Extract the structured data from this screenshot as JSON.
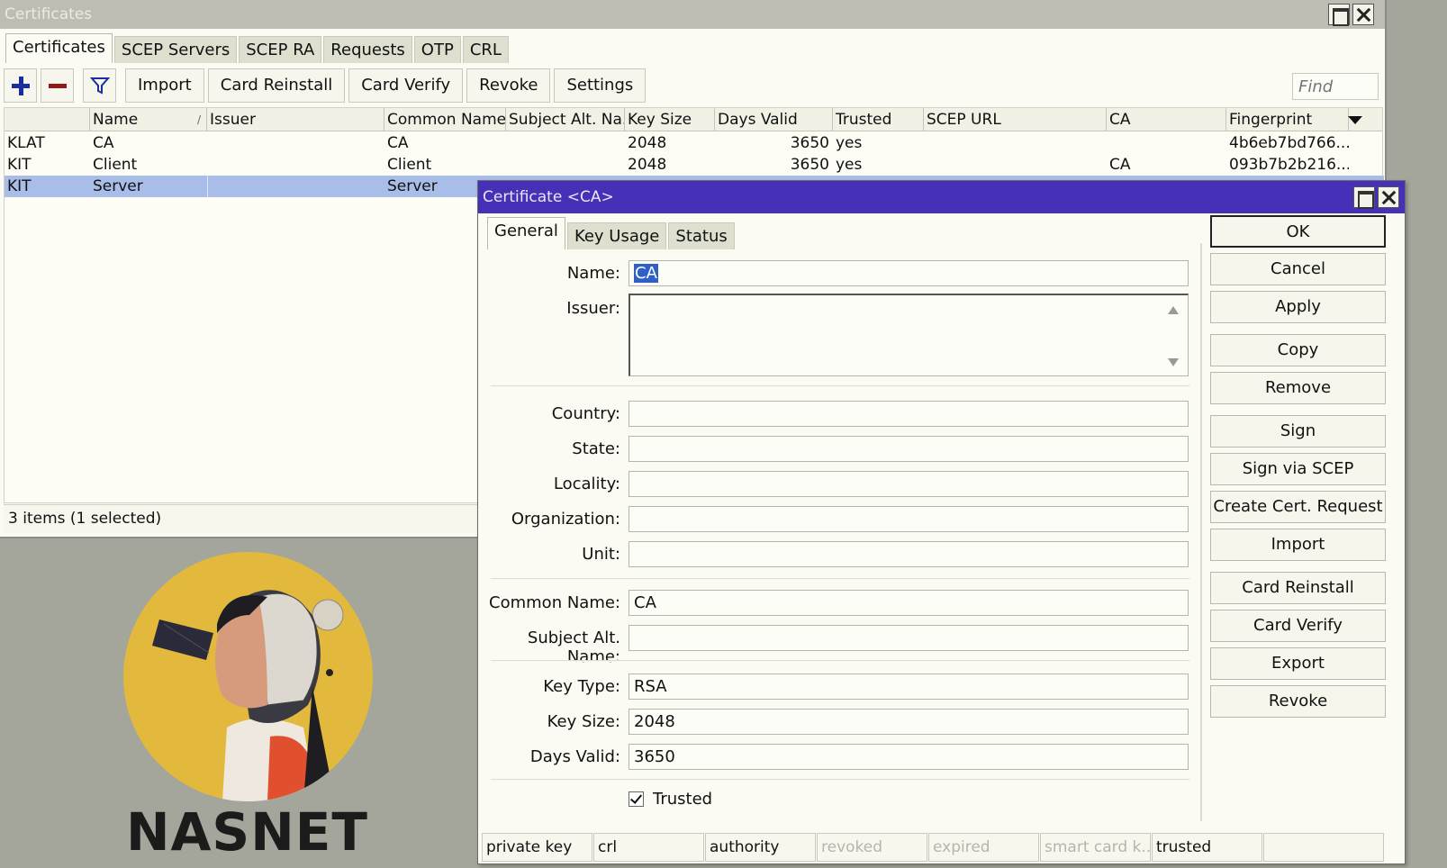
{
  "certs_window": {
    "title": "Certificates",
    "tabs": [
      {
        "label": "Certificates",
        "active": true
      },
      {
        "label": "SCEP Servers",
        "active": false
      },
      {
        "label": "SCEP RA",
        "active": false
      },
      {
        "label": "Requests",
        "active": false
      },
      {
        "label": "OTP",
        "active": false
      },
      {
        "label": "CRL",
        "active": false
      }
    ],
    "toolbar": {
      "add_icon": "plus-icon",
      "remove_icon": "minus-icon",
      "filter_icon": "filter-icon",
      "buttons": [
        "Import",
        "Card Reinstall",
        "Card Verify",
        "Revoke",
        "Settings"
      ]
    },
    "find_placeholder": "Find",
    "columns": [
      "",
      "Name",
      "Issuer",
      "Common Name",
      "Subject Alt. Na...",
      "Key Size",
      "Days Valid",
      "Trusted",
      "SCEP URL",
      "CA",
      "Fingerprint"
    ],
    "rows": [
      {
        "flags": "KLAT",
        "name": "CA",
        "issuer": "",
        "common_name": "CA",
        "san": "",
        "key_size": "2048",
        "days_valid": "3650",
        "trusted": "yes",
        "scep_url": "",
        "ca": "",
        "fingerprint": "4b6eb7bd766...",
        "selected": false
      },
      {
        "flags": "KIT",
        "name": "Client",
        "issuer": "",
        "common_name": "Client",
        "san": "",
        "key_size": "2048",
        "days_valid": "3650",
        "trusted": "yes",
        "scep_url": "",
        "ca": "CA",
        "fingerprint": "093b7b2b216...",
        "selected": false
      },
      {
        "flags": "KIT",
        "name": "Server",
        "issuer": "",
        "common_name": "Server",
        "san": "",
        "key_size": "",
        "days_valid": "",
        "trusted": "",
        "scep_url": "",
        "ca": "",
        "fingerprint": "",
        "selected": true
      }
    ],
    "status": "3 items (1 selected)"
  },
  "ca_dialog": {
    "title": "Certificate <CA>",
    "tabs": [
      {
        "label": "General",
        "active": true
      },
      {
        "label": "Key Usage",
        "active": false
      },
      {
        "label": "Status",
        "active": false
      }
    ],
    "fields": {
      "name_label": "Name:",
      "name_value": "CA",
      "issuer_label": "Issuer:",
      "issuer_value": "",
      "country_label": "Country:",
      "country_value": "",
      "state_label": "State:",
      "state_value": "",
      "locality_label": "Locality:",
      "locality_value": "",
      "organization_label": "Organization:",
      "organization_value": "",
      "unit_label": "Unit:",
      "unit_value": "",
      "common_name_label": "Common Name:",
      "common_name_value": "CA",
      "san_label": "Subject Alt. Name:",
      "san_value": "",
      "key_type_label": "Key Type:",
      "key_type_value": "RSA",
      "key_size_label": "Key Size:",
      "key_size_value": "2048",
      "days_valid_label": "Days Valid:",
      "days_valid_value": "3650"
    },
    "trusted_label": "Trusted",
    "trusted_checked": true,
    "buttons": {
      "ok": "OK",
      "cancel": "Cancel",
      "apply": "Apply",
      "copy": "Copy",
      "remove": "Remove",
      "sign": "Sign",
      "sign_scep": "Sign via SCEP",
      "create_req": "Create Cert. Request",
      "import": "Import",
      "card_reinstall": "Card Reinstall",
      "card_verify": "Card Verify",
      "export": "Export",
      "revoke": "Revoke"
    },
    "status_flags": [
      {
        "label": "private key",
        "on": true
      },
      {
        "label": "crl",
        "on": true
      },
      {
        "label": "authority",
        "on": true
      },
      {
        "label": "revoked",
        "on": false
      },
      {
        "label": "expired",
        "on": false
      },
      {
        "label": "smart card k...",
        "on": false
      },
      {
        "label": "trusted",
        "on": true
      },
      {
        "label": "",
        "on": true
      }
    ]
  },
  "logo": {
    "text": "NASNET"
  },
  "colors": {
    "dialog_title": "#4730b8",
    "selection": "#a9bde9",
    "logo_bg": "#e2b93d",
    "add_icon": "#1a2ea0",
    "remove_icon": "#8e1a1a"
  }
}
